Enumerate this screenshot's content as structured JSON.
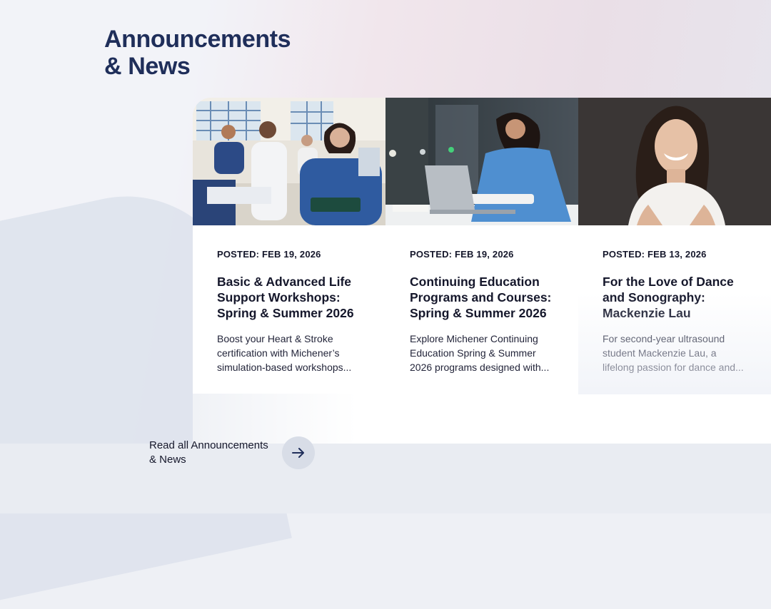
{
  "section": {
    "title_line1": "Announcements",
    "title_line2": "& News"
  },
  "cards": [
    {
      "posted": "POSTED: FEB 19, 2026",
      "title": "Basic & Advanced Life Support Workshops: Spring & Summer 2026",
      "excerpt": "Boost your Heart & Stroke certification with Michener’s simulation-based workshops...",
      "image": "classroom-healthcare-students-photo"
    },
    {
      "posted": "POSTED: FEB 19, 2026",
      "title": "Continuing Education Programs and Courses: Spring & Summer 2026",
      "excerpt": "Explore Michener Continuing Education Spring & Summer 2026 programs designed with...",
      "image": "student-laptop-photo"
    },
    {
      "posted": "POSTED: FEB 13, 2026",
      "title": "For the Love of Dance and Sonography: Mackenzie Lau",
      "excerpt": "For second-year ultrasound student Mackenzie Lau, a lifelong passion for dance and...",
      "image": "student-portrait-photo"
    }
  ],
  "read_all": {
    "label": "Read all Announcements & News",
    "icon": "arrow-right-icon"
  },
  "colors": {
    "heading": "#1f2e5a",
    "text": "#15172b",
    "arrow_bg": "#d8dde7"
  }
}
